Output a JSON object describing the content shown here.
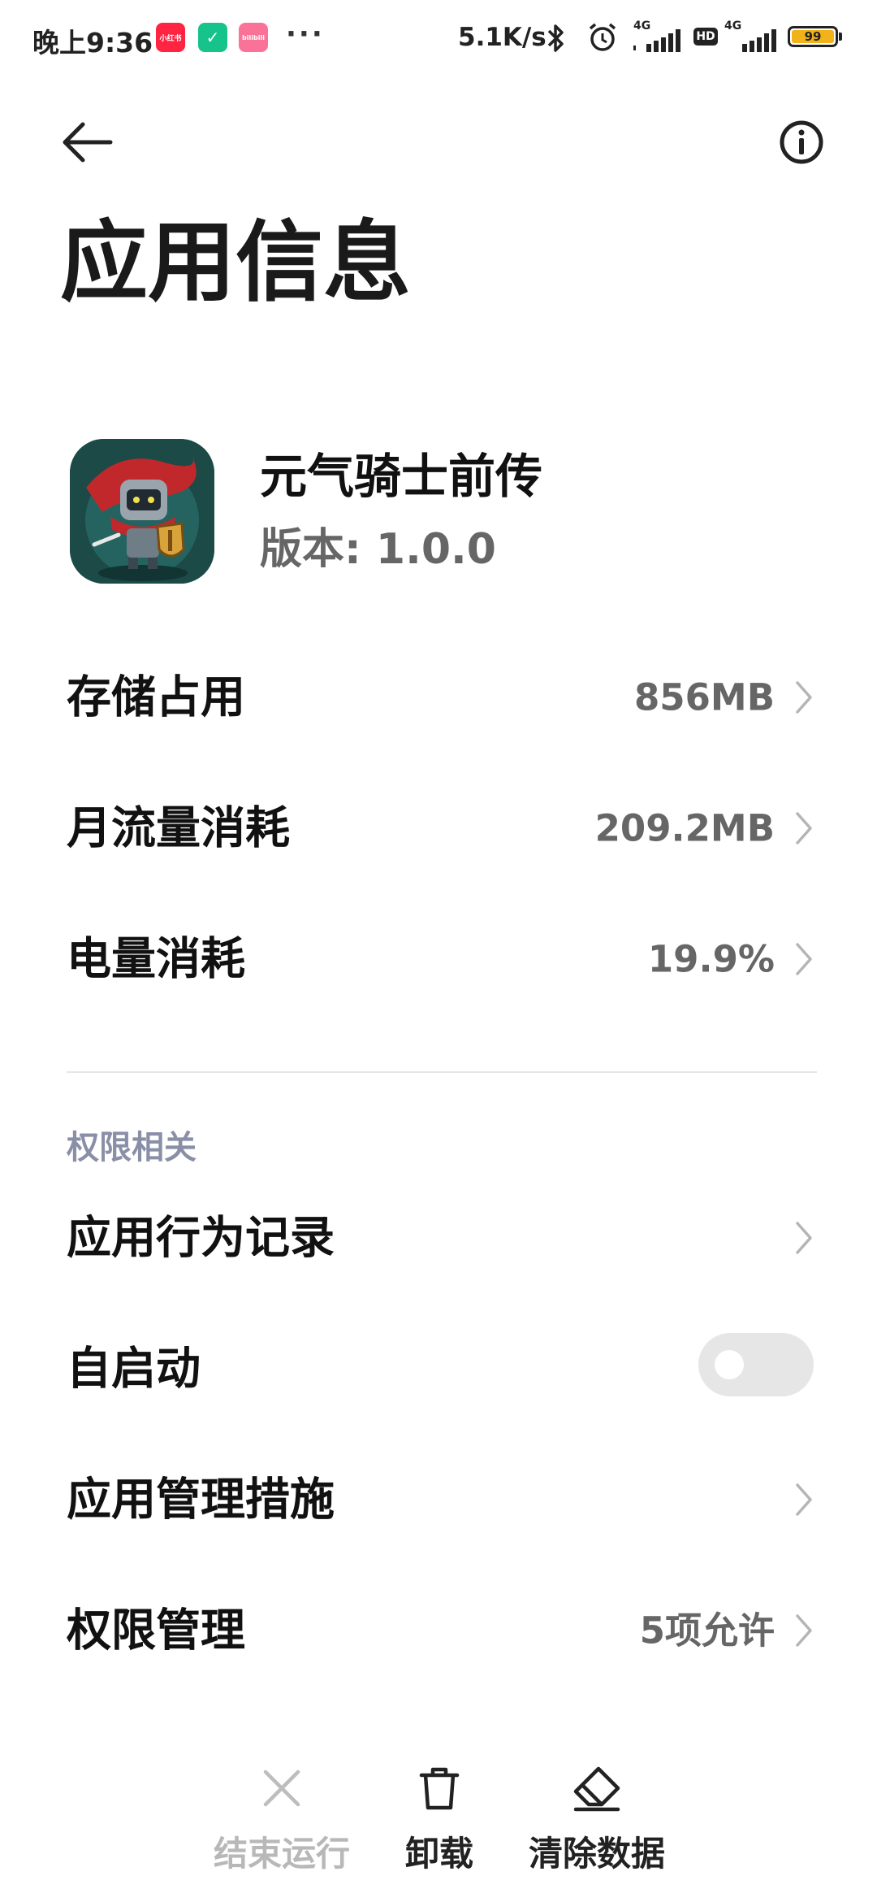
{
  "status_bar": {
    "time": "晚上9:36",
    "notification_apps": [
      {
        "name": "小红书",
        "label": "小红书",
        "color": "#ff2442"
      },
      {
        "name": "security",
        "label": "✓",
        "color": "#16c38b"
      },
      {
        "name": "bilibili",
        "label": "bilibili",
        "color": "#fb7299"
      }
    ],
    "more_dots": "···",
    "network_speed": "5.1K/s",
    "sim1_type": "4G",
    "hd_label": "HD",
    "sim2_type": "4G",
    "battery_level": "99"
  },
  "header": {
    "title": "应用信息"
  },
  "app": {
    "name": "元气骑士前传",
    "version": "版本: 1.0.0"
  },
  "usage_rows": [
    {
      "label": "存储占用",
      "value": "856MB"
    },
    {
      "label": "月流量消耗",
      "value": "209.2MB"
    },
    {
      "label": "电量消耗",
      "value": "19.9%"
    }
  ],
  "permissions": {
    "section_title": "权限相关",
    "behavior_record": {
      "label": "应用行为记录"
    },
    "autostart": {
      "label": "自启动",
      "enabled": false
    },
    "management_measures": {
      "label": "应用管理措施"
    },
    "permission_management": {
      "label": "权限管理",
      "value": "5项允许"
    }
  },
  "actions": {
    "stop": {
      "label": "结束运行",
      "enabled": false
    },
    "uninstall": {
      "label": "卸载",
      "enabled": true
    },
    "clear_data": {
      "label": "清除数据",
      "enabled": true
    }
  },
  "colors": {
    "section_title": "#8a8fa8",
    "secondary_text": "#666666",
    "disabled_text": "#b8b8b8",
    "toggle_off": "#e6e6e6",
    "battery": "#f2b21a"
  }
}
